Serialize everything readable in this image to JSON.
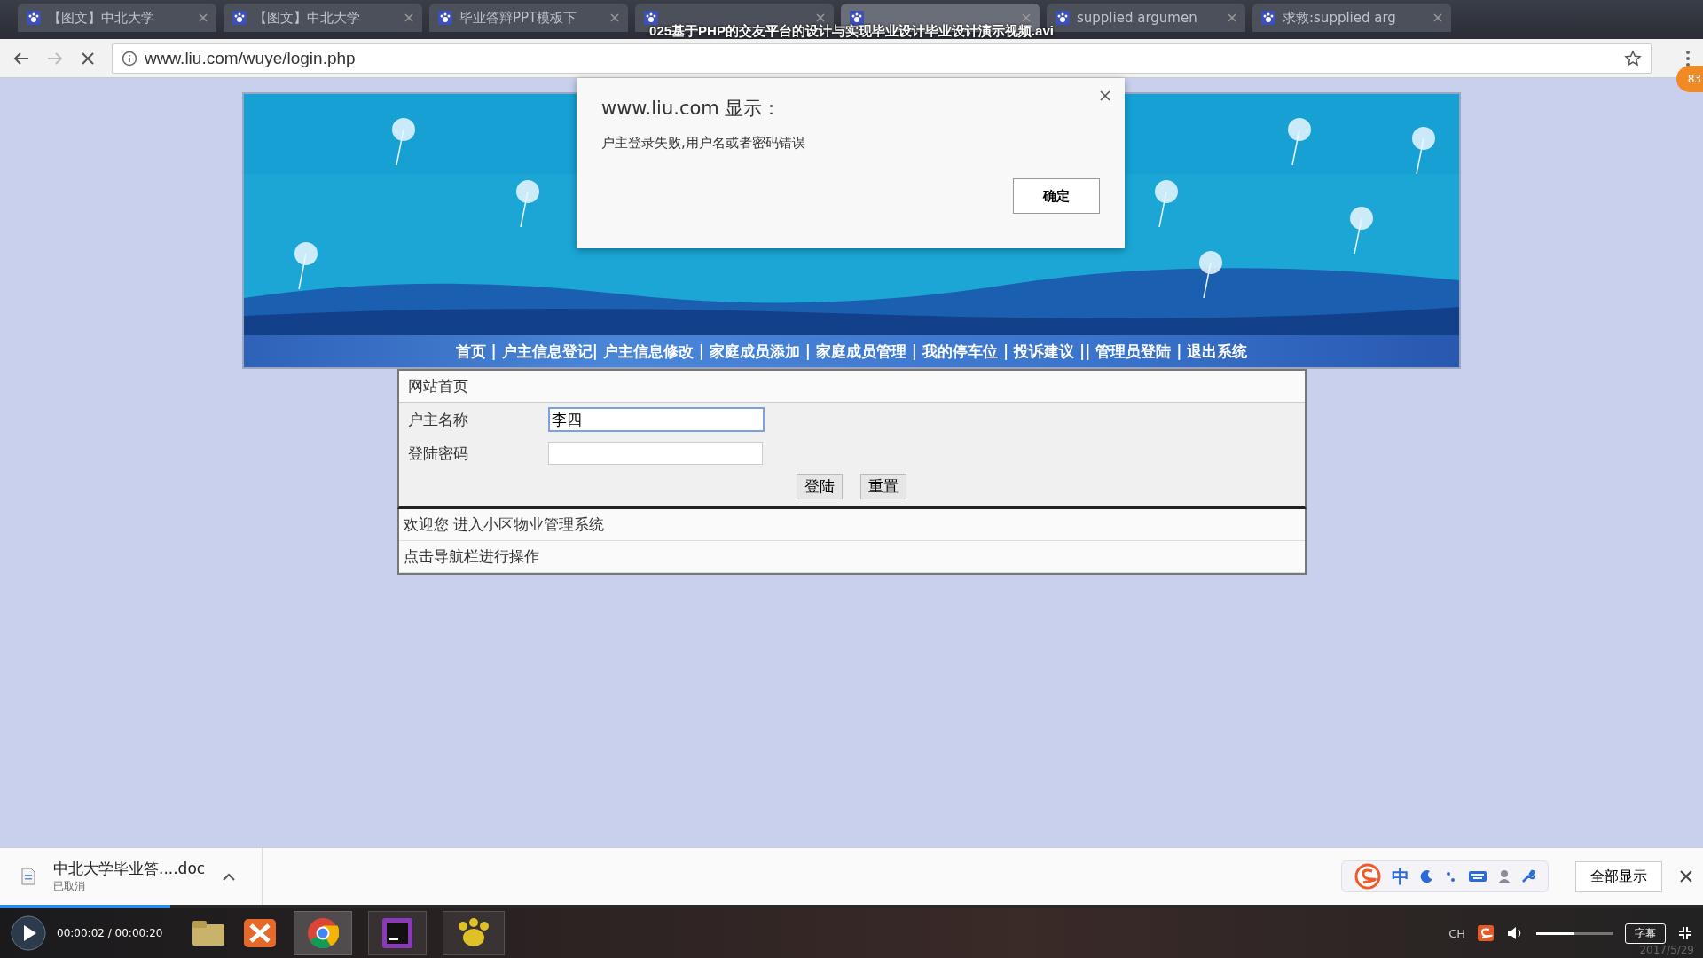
{
  "video_title": "025基于PHP的交友平台的设计与实现毕业设计毕业设计演示视频.avi",
  "browser": {
    "tabs": [
      {
        "label": "【图文】中北大学",
        "selected": false
      },
      {
        "label": "【图文】中北大学",
        "selected": false
      },
      {
        "label": "毕业答辩PPT模板下",
        "selected": false
      },
      {
        "selected": false
      },
      {
        "selected": true
      },
      {
        "label": "supplied argumen",
        "selected": false
      },
      {
        "label": "求救:supplied arg",
        "selected": false
      }
    ],
    "loading": true,
    "url": "www.liu.com/wuye/login.php",
    "badge": "83"
  },
  "dialog": {
    "title": "www.liu.com 显示：",
    "message": "户主登录失败,用户名或者密码错误",
    "ok": "确定"
  },
  "nav": [
    {
      "label": "首页",
      "separator": " | "
    },
    {
      "label": "户主信息登记",
      "separator": "| "
    },
    {
      "label": "户主信息修改",
      "separator": " | "
    },
    {
      "label": "家庭成员添加",
      "separator": " | "
    },
    {
      "label": "家庭成员管理",
      "separator": " | "
    },
    {
      "label": "我的停车位",
      "separator": " | "
    },
    {
      "label": "投诉建议",
      "separator": " || "
    },
    {
      "label": "管理员登陆",
      "separator": " | "
    },
    {
      "label": "退出系统"
    }
  ],
  "form": {
    "heading": "网站首页",
    "fields": [
      {
        "label": "户主名称",
        "value": "李四",
        "focused": true
      },
      {
        "label": "登陆密码",
        "focused": false
      }
    ],
    "buttons": [
      "登陆",
      "重置"
    ]
  },
  "messages": [
    "欢迎您 进入小区物业管理系统",
    "点击导航栏进行操作"
  ],
  "downloads": {
    "file": "中北大学毕业答....doc",
    "status": "已取消",
    "show_all": "全部显示"
  },
  "ime": {
    "mode": "中"
  },
  "player": {
    "time": "00:00:02 / 00:00:20",
    "level": 0.1,
    "volume": {
      "level": 0.5
    },
    "lang": "CH",
    "subtitle": "字幕",
    "date": "2017/5/29"
  }
}
